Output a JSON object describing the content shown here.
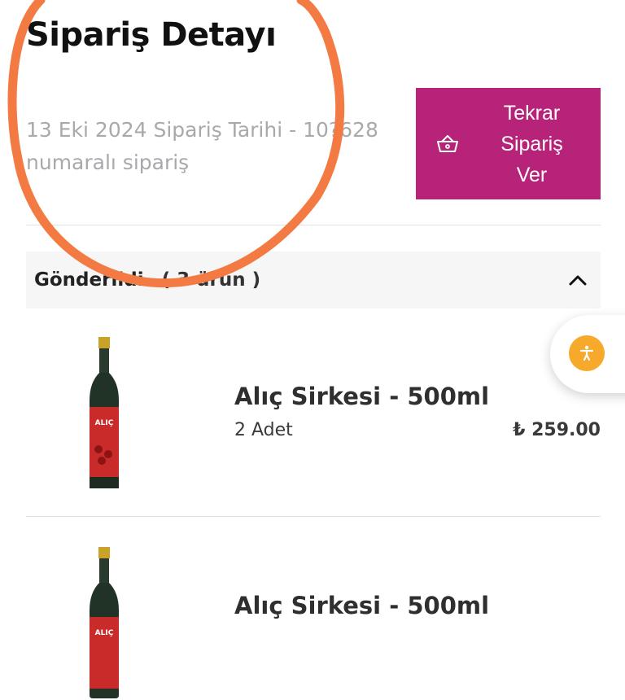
{
  "header": {
    "title": "Sipariş Detayı",
    "meta_line1": "13 Eki 2024 Sipariş Tarihi - 10?628",
    "meta_line2": "numaralı sipariş"
  },
  "actions": {
    "reorder_label": "Tekrar\nSipariş\nVer",
    "reorder_icon": "basket-icon"
  },
  "shipment": {
    "status": "Gönderildi",
    "count": "( 3 ürün )",
    "expanded": true
  },
  "items": [
    {
      "name": "Alıç Sirkesi - 500ml",
      "qty": "2 Adet",
      "price": "₺ 259.00",
      "label": "ALIÇ"
    },
    {
      "name": "Alıç Sirkesi - 500ml",
      "label": "ALIÇ"
    }
  ],
  "accessibility": {
    "icon": "accessibility-icon"
  },
  "colors": {
    "brand": "#b8237a",
    "accessibility": "#f7a92b",
    "annotation": "#f47a43"
  }
}
